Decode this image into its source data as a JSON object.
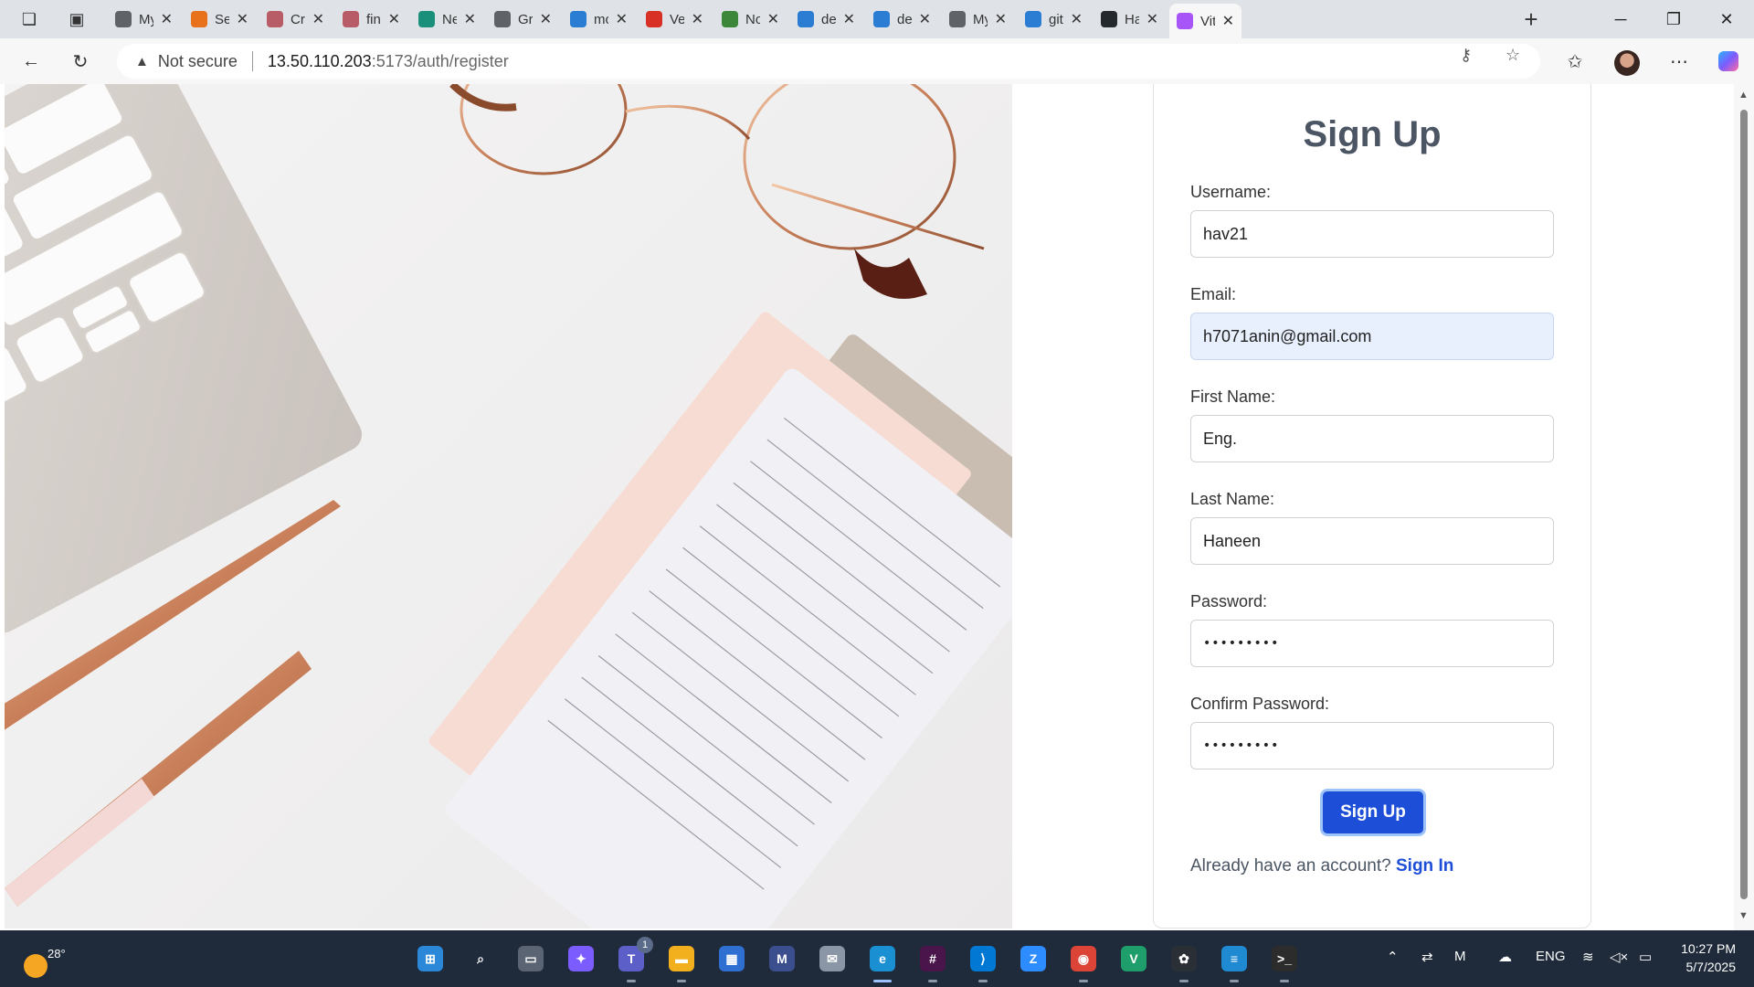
{
  "browser": {
    "tabs": [
      {
        "label": "My",
        "icon": "globe-icon",
        "color": "#5f6368"
      },
      {
        "label": "Secu",
        "icon": "security-icon",
        "color": "#e8711c"
      },
      {
        "label": "Crea",
        "icon": "doc-icon",
        "color": "#b85c68"
      },
      {
        "label": "find",
        "icon": "doc-icon",
        "color": "#b85c68"
      },
      {
        "label": "Net",
        "icon": "netlify-icon",
        "color": "#1a8f7a"
      },
      {
        "label": "Grap",
        "icon": "globe-icon",
        "color": "#5f6368"
      },
      {
        "label": "mor",
        "icon": "search-icon",
        "color": "#2b7cd3"
      },
      {
        "label": "Veri",
        "icon": "gmail-icon",
        "color": "#d93025"
      },
      {
        "label": "Noc",
        "icon": "node-icon",
        "color": "#3c873a"
      },
      {
        "label": "des",
        "icon": "search-icon",
        "color": "#2b7cd3"
      },
      {
        "label": "des",
        "icon": "search-icon",
        "color": "#2b7cd3"
      },
      {
        "label": "My",
        "icon": "globe-icon",
        "color": "#5f6368"
      },
      {
        "label": "gith",
        "icon": "search-icon",
        "color": "#2b7cd3"
      },
      {
        "label": "Han",
        "icon": "github-icon",
        "color": "#24292e"
      },
      {
        "label": "Vite",
        "icon": "vite-icon",
        "color": "#a855f7"
      }
    ],
    "address": {
      "security_label": "Not secure",
      "host": "13.50.110.203",
      "path": ":5173/auth/register"
    }
  },
  "form": {
    "title": "Sign Up",
    "username_label": "Username:",
    "username_value": "hav21",
    "email_label": "Email:",
    "email_value": "h7071anin@gmail.com",
    "first_name_label": "First Name:",
    "first_name_value": "Eng.",
    "last_name_label": "Last Name:",
    "last_name_value": "Haneen",
    "password_label": "Password:",
    "password_value": "•••••••••",
    "confirm_password_label": "Confirm Password:",
    "confirm_password_value": "•••••••••",
    "submit_label": "Sign Up",
    "signin_prompt": "Already have an account?",
    "signin_link": "Sign In",
    "accent_color": "#1d4ed8"
  },
  "taskbar": {
    "weather_temp": "28°",
    "apps": [
      {
        "name": "start-button",
        "color": "#2b88d8",
        "glyph": "⊞"
      },
      {
        "name": "search-icon",
        "color": "#1f2a3a",
        "glyph": "⌕"
      },
      {
        "name": "task-view-icon",
        "color": "#5a6472",
        "glyph": "▭"
      },
      {
        "name": "copilot-icon",
        "color": "#7b5cff",
        "glyph": "✦"
      },
      {
        "name": "teams-icon",
        "color": "#5b5fc7",
        "glyph": "T"
      },
      {
        "name": "file-explorer-icon",
        "color": "#f2b01e",
        "glyph": "▬"
      },
      {
        "name": "store-icon",
        "color": "#2f6fd1",
        "glyph": "▦"
      },
      {
        "name": "mail-app-icon",
        "color": "#3b4f8f",
        "glyph": "M"
      },
      {
        "name": "mail-icon",
        "color": "#8a95a5",
        "glyph": "✉"
      },
      {
        "name": "edge-icon",
        "color": "#1a8fd1",
        "glyph": "e"
      },
      {
        "name": "slack-icon",
        "color": "#4a154b",
        "glyph": "#"
      },
      {
        "name": "vscode-icon",
        "color": "#0078d4",
        "glyph": "⟩"
      },
      {
        "name": "zoom-icon",
        "color": "#2d8cff",
        "glyph": "Z"
      },
      {
        "name": "chrome-icon",
        "color": "#db4437",
        "glyph": "◉"
      },
      {
        "name": "vs-icon",
        "color": "#1e9e6a",
        "glyph": "V"
      },
      {
        "name": "chatgpt-icon",
        "color": "#2a2f36",
        "glyph": "✿"
      },
      {
        "name": "notepad-icon",
        "color": "#1f8ad2",
        "glyph": "≡"
      },
      {
        "name": "terminal-icon",
        "color": "#2c2c2c",
        "glyph": ">_"
      }
    ],
    "teams_badge": "1",
    "lang": "ENG",
    "time": "10:27 PM",
    "date": "5/7/2025"
  }
}
